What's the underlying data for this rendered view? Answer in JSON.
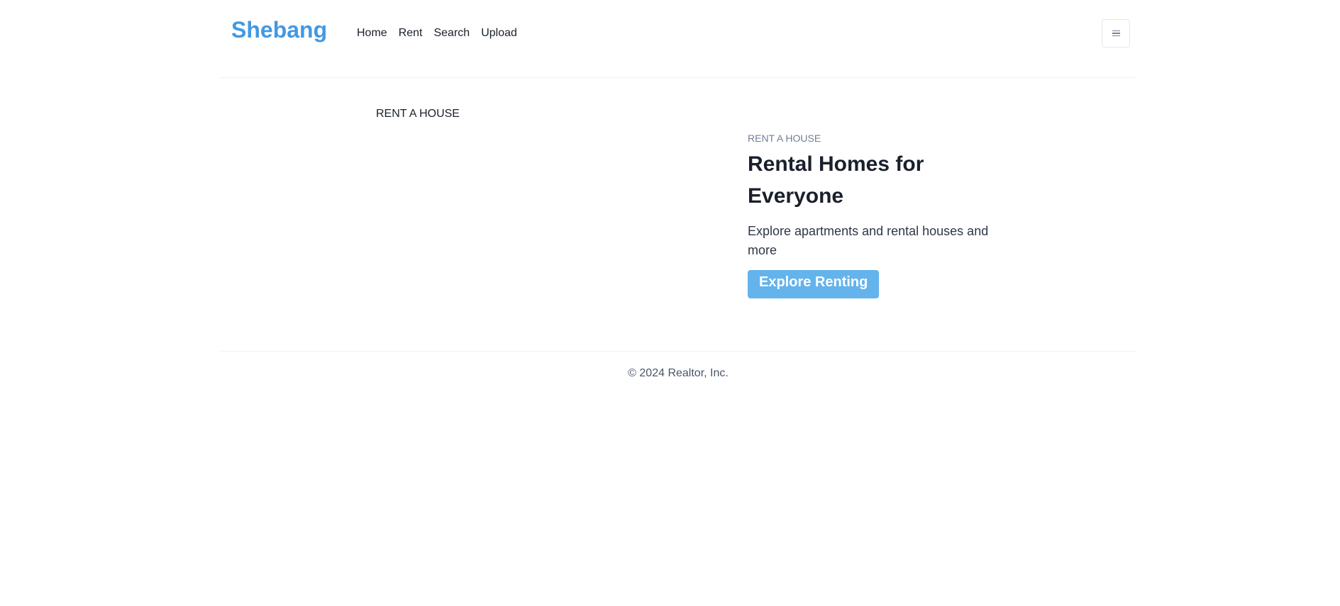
{
  "header": {
    "logo": "Shebang",
    "nav": {
      "home": "Home",
      "rent": "Rent",
      "search": "Search",
      "upload": "Upload"
    },
    "menu_icon": "hamburger-icon"
  },
  "main": {
    "image_alt": "RENT A HOUSE",
    "eyebrow": "RENT A HOUSE",
    "headline": "Rental Homes for Everyone",
    "subtext": "Explore apartments and rental houses and more",
    "cta_label": "Explore Renting"
  },
  "footer": {
    "copyright": "© 2024 Realtor, Inc."
  },
  "colors": {
    "brand": "#4299e1",
    "cta": "#63b3ed",
    "border": "#edf2f7"
  }
}
